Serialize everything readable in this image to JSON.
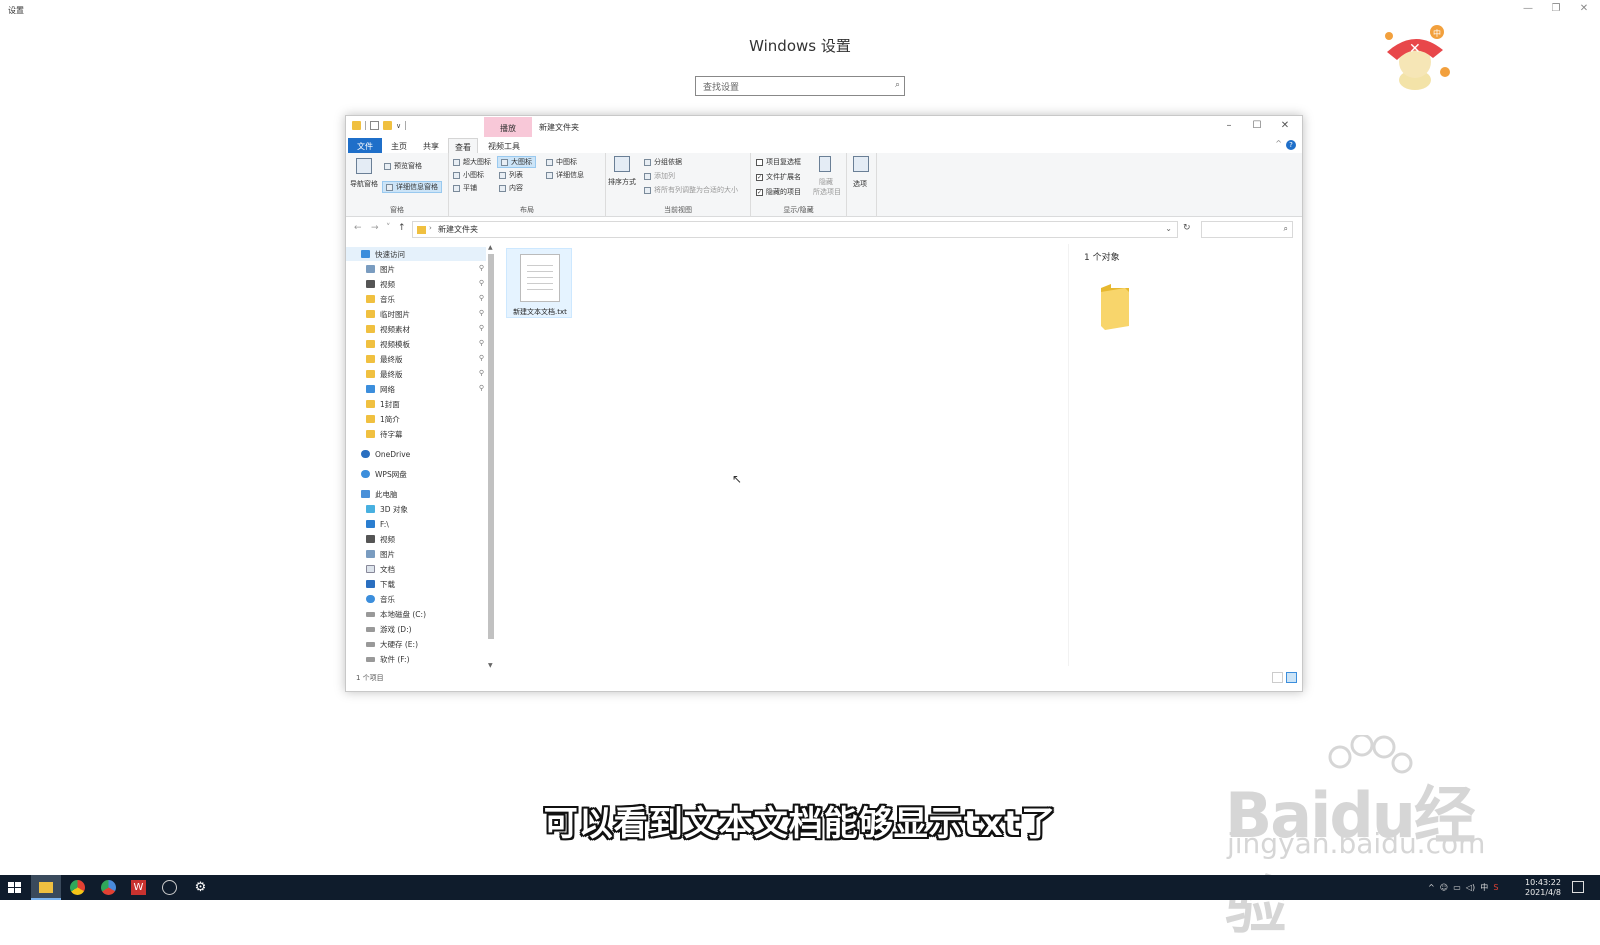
{
  "settings": {
    "window_title": "设置",
    "heading": "Windows 设置",
    "search_placeholder": "查找设置"
  },
  "explorer": {
    "title": "新建文件夹",
    "context_tab": "播放",
    "ribbon_tabs": [
      "文件",
      "主页",
      "共享",
      "查看",
      "视频工具"
    ],
    "ribbon": {
      "pane_group": {
        "nav_pane": "导航窗格",
        "preview_pane": "预览窗格",
        "details_pane": "详细信息窗格",
        "label": "窗格"
      },
      "layout_group": {
        "extra_large": "超大图标",
        "large": "大图标",
        "medium": "中图标",
        "small": "小图标",
        "list": "列表",
        "details": "详细信息",
        "tiles": "平铺",
        "content": "内容",
        "label": "布局"
      },
      "current_view_group": {
        "sort_by": "排序方式",
        "group_by": "分组依据",
        "add_columns": "添加列",
        "size_all": "将所有列调整为合适的大小",
        "label": "当前视图"
      },
      "show_hide_group": {
        "item_checkboxes": "项目复选框",
        "file_extensions": "文件扩展名",
        "hidden_items": "隐藏的项目",
        "hide_selected_1": "隐藏",
        "hide_selected_2": "所选项目",
        "label": "显示/隐藏"
      },
      "options": "选项"
    },
    "address": {
      "path": "新建文件夹"
    },
    "nav_items": [
      {
        "label": "快速访问",
        "icon": "star-icon",
        "pinned": false
      },
      {
        "label": "图片",
        "icon": "pictures-icon",
        "pinned": true
      },
      {
        "label": "视频",
        "icon": "video-icon",
        "pinned": true
      },
      {
        "label": "音乐",
        "icon": "folder-icon",
        "pinned": true
      },
      {
        "label": "临时图片",
        "icon": "folder-icon",
        "pinned": true
      },
      {
        "label": "视频素材",
        "icon": "folder-icon",
        "pinned": true
      },
      {
        "label": "视频模板",
        "icon": "folder-icon",
        "pinned": true
      },
      {
        "label": "最终版",
        "icon": "folder-icon",
        "pinned": true
      },
      {
        "label": "最终版",
        "icon": "folder-icon",
        "pinned": true
      },
      {
        "label": "网络",
        "icon": "network-icon",
        "pinned": true
      },
      {
        "label": "1封面",
        "icon": "folder-icon",
        "pinned": false
      },
      {
        "label": "1简介",
        "icon": "folder-icon",
        "pinned": false
      },
      {
        "label": "待字幕",
        "icon": "folder-icon",
        "pinned": false
      },
      {
        "label": "OneDrive",
        "icon": "cloud-icon",
        "pinned": false
      },
      {
        "label": "WPS网盘",
        "icon": "cloud-icon",
        "pinned": false
      },
      {
        "label": "此电脑",
        "icon": "computer-icon",
        "pinned": false
      },
      {
        "label": "3D 对象",
        "icon": "cube-icon",
        "pinned": false
      },
      {
        "label": "F:\\",
        "icon": "drive-icon",
        "pinned": false
      },
      {
        "label": "视频",
        "icon": "video-icon",
        "pinned": false
      },
      {
        "label": "图片",
        "icon": "pictures-icon",
        "pinned": false
      },
      {
        "label": "文档",
        "icon": "document-icon",
        "pinned": false
      },
      {
        "label": "下载",
        "icon": "download-icon",
        "pinned": false
      },
      {
        "label": "音乐",
        "icon": "music-icon",
        "pinned": false
      },
      {
        "label": "本地磁盘 (C:)",
        "icon": "disk-icon",
        "pinned": false
      },
      {
        "label": "游戏 (D:)",
        "icon": "disk-icon",
        "pinned": false
      },
      {
        "label": "大硬存 (E:)",
        "icon": "disk-icon",
        "pinned": false
      },
      {
        "label": "软件 (F:)",
        "icon": "disk-icon",
        "pinned": false
      }
    ],
    "file": {
      "name": "新建文本文档.txt"
    },
    "preview_count": "1 个对象",
    "status": "1 个项目"
  },
  "subtitle": "可以看到文本文档能够显示txt了",
  "watermark": {
    "main": "Baidu经验",
    "sub": "jingyan.baidu.com"
  },
  "taskbar": {
    "ime": "中",
    "time": "10:43:22",
    "date": "2021/4/8"
  },
  "colors": {
    "accent": "#1f6fc9",
    "taskbar": "#0f1c2c",
    "folder": "#f0c040",
    "context_tab": "#f8c8d8"
  }
}
